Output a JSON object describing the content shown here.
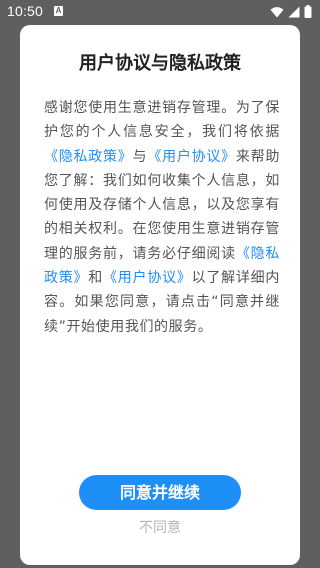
{
  "status_bar": {
    "time": "10:50",
    "notification_icon": "a-badge-icon",
    "icons": [
      "wifi-icon",
      "signal-icon",
      "battery-icon"
    ]
  },
  "dialog": {
    "title": "用户协议与隐私政策",
    "body": {
      "p1": "感谢您使用生意进销存管理。为了保护您的个人信息安全，我们将依据",
      "link_privacy_1": "《隐私政策》",
      "p2": "与",
      "link_user_1": "《用户协议》",
      "p3": "来帮助您了解：我们如何收集个人信息，如何使用及存储个人信息，以及您享有的相关权利。在您使用生意进销存管理的服务前，请务必仔细阅读",
      "link_privacy_2": "《隐私政策》",
      "p4": "和",
      "link_user_2": "《用户协议》",
      "p5": "以了解详细内容。如果您同意，请点击“同意并继续”开始使用我们的服务。"
    },
    "agree_label": "同意并继续",
    "disagree_label": "不同意"
  },
  "colors": {
    "overlay": "#5f5f5f",
    "accent": "#1f8ff8",
    "body_text": "#555555",
    "muted": "#b5b5b5"
  }
}
